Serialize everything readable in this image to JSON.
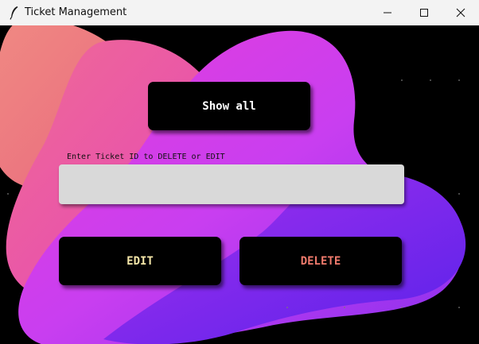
{
  "window": {
    "title": "Ticket Management",
    "controls": {
      "minimize": "minimize-icon",
      "maximize": "maximize-icon",
      "close": "close-icon"
    }
  },
  "main": {
    "show_all_label": "Show all",
    "entry_label": "Enter Ticket ID to DELETE or EDIT",
    "entry_value": "",
    "edit_label": "EDIT",
    "delete_label": "DELETE"
  },
  "colors": {
    "background": "#000000",
    "titlebar": "#f3f3f3",
    "button_bg": "#000000",
    "show_all_text": "#ffffff",
    "edit_text": "#f5e6a8",
    "delete_text": "#f07a6c",
    "entry_bg": "#d9d9d9",
    "blob_coral": "#ef7f85",
    "blob_pink": "#ee5aa8",
    "blob_magenta": "#d63be8",
    "blob_violet": "#6a25ec"
  }
}
